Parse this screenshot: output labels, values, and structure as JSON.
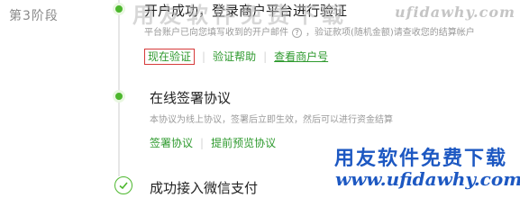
{
  "stage": {
    "label": "第3阶段"
  },
  "steps": [
    {
      "title": "开户成功，登录商户平台进行验证",
      "description": "平台账户已向您填写收到的开户邮件",
      "description_tail": "，验证款项(随机金额)请查收您的结算帐户",
      "links": [
        "现在验证",
        "验证帮助",
        "查看商户号"
      ]
    },
    {
      "title": "在线签署协议",
      "description": "本协议为线上协议，签署后立即生效，然后可以进行资金结算",
      "links": [
        "签署协议",
        "提前预览协议"
      ]
    },
    {
      "title": "成功接入微信支付"
    }
  ],
  "watermark": {
    "top_cn": "用友软件免费下载",
    "top_url": "ufidawhy.com",
    "logo_cn": "用友软件免费下载",
    "logo_url": "www.ufidawhy.com"
  },
  "colors": {
    "accent": "#4cb72d",
    "link": "#2f9a2f",
    "highlight_box": "#d63a3a",
    "watermark_blue": "#1d58c2"
  },
  "icons": {
    "help": "question-circle-icon",
    "done": "check-circle-icon"
  }
}
